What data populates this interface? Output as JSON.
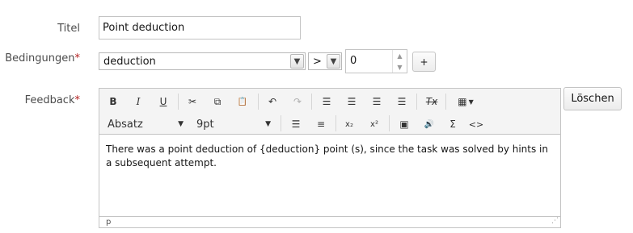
{
  "form": {
    "title_label": "Titel",
    "title_value": "Point deduction",
    "conditions_label": "Bedingungen",
    "required_mark": "*",
    "condition_select": "deduction",
    "operator_select": ">",
    "number_value": "0",
    "add_button": "+",
    "feedback_label": "Feedback",
    "delete_button": "Löschen"
  },
  "editor": {
    "toolbar": {
      "bold": "B",
      "italic": "I",
      "underline": "U",
      "cut": "✂",
      "copy": "⧉",
      "paste": "📋",
      "undo": "↶",
      "redo": "↷",
      "clear_format": "Tx",
      "table": "▦",
      "format_dropdown": "Absatz",
      "font_size_dropdown": "9pt",
      "bullet_list": "☰",
      "numbered_list": "≡",
      "subscript": "x₂",
      "superscript": "x²",
      "image": "▣",
      "media": "🔊",
      "sum": "Σ",
      "code": "<>"
    },
    "content": "There was a point deduction of {deduction} point (s), since the task was solved by hints in a subsequent attempt.",
    "statusbar": "p"
  },
  "icons": {
    "select_arrow": "chevron-down-icon",
    "spinner": "spinner-arrows-icon",
    "resize": "resize-grip-icon"
  }
}
